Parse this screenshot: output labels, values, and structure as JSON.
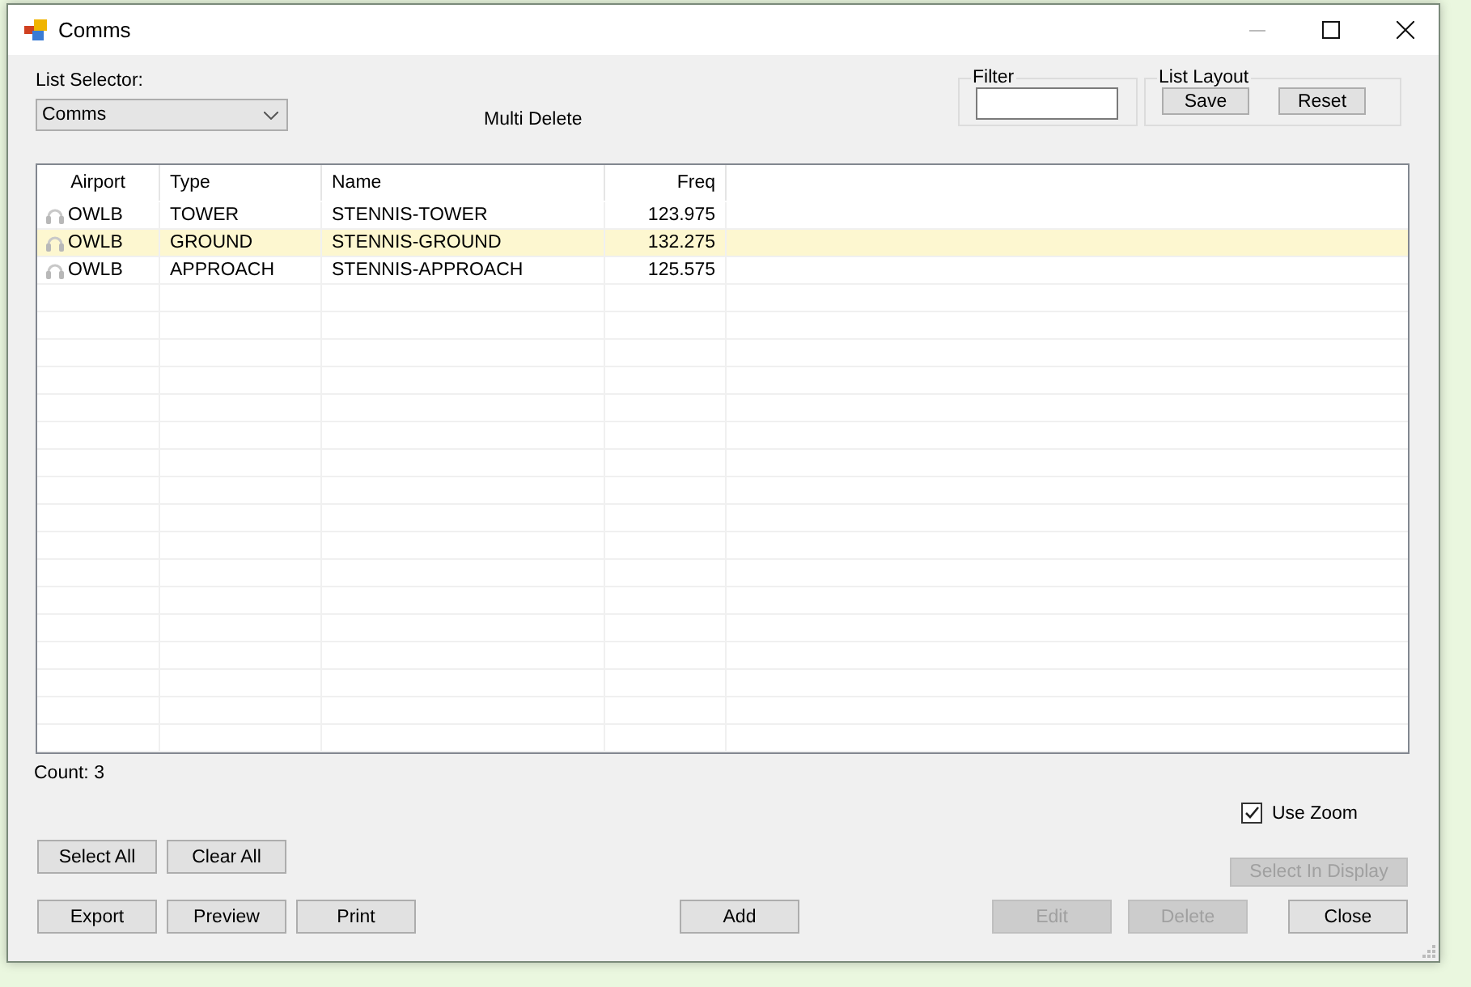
{
  "window": {
    "title": "Comms"
  },
  "list_selector": {
    "label": "List Selector:",
    "value": "Comms"
  },
  "multi_delete": "Multi Delete",
  "filter": {
    "label": "Filter"
  },
  "list_layout": {
    "label": "List Layout",
    "buttons": [
      {
        "label": "Save"
      },
      {
        "label": "Reset"
      }
    ]
  },
  "table": {
    "columns": [
      {
        "label": "Airport"
      },
      {
        "label": "Type"
      },
      {
        "label": "Name"
      },
      {
        "label": "Freq"
      }
    ],
    "rows": [
      {
        "cells": [
          "OWLB",
          "TOWER",
          "STENNIS-TOWER",
          "123.975"
        ],
        "selected": false
      },
      {
        "cells": [
          "OWLB",
          "GROUND",
          "STENNIS-GROUND",
          "132.275"
        ],
        "selected": true
      },
      {
        "cells": [
          "OWLB",
          "APPROACH",
          "STENNIS-APPROACH",
          "125.575"
        ],
        "selected": false
      }
    ]
  },
  "count": "Count: 3",
  "use_zoom": {
    "label": "Use Zoom",
    "checked": true
  },
  "select_buttons": [
    {
      "label": "Select All",
      "disabled": false
    },
    {
      "label": "Clear All",
      "disabled": false
    }
  ],
  "select_in_display": {
    "label": "Select In Display",
    "disabled": true
  },
  "left_buttons": [
    {
      "label": "Export",
      "disabled": false
    },
    {
      "label": "Preview",
      "disabled": false
    },
    {
      "label": "Print",
      "disabled": false
    }
  ],
  "center_buttons": [
    {
      "label": "Add",
      "disabled": false
    }
  ],
  "right_buttons": [
    {
      "label": "Edit",
      "disabled": true
    },
    {
      "label": "Delete",
      "disabled": true
    },
    {
      "label": "Close",
      "disabled": false
    }
  ]
}
